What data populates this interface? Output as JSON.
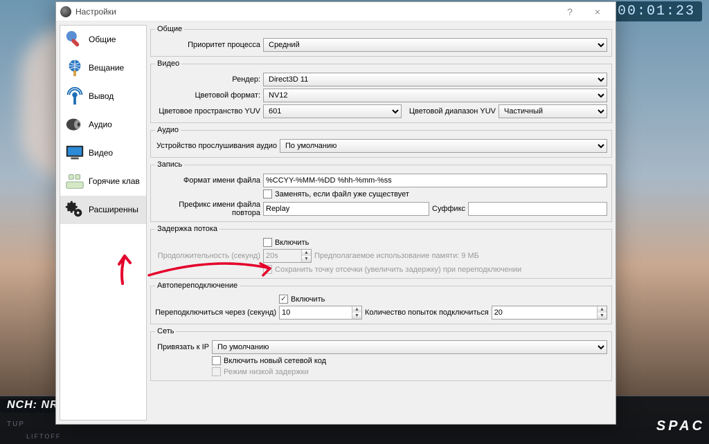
{
  "window": {
    "title": "Настройки",
    "help_btn": "?",
    "close_btn": "×"
  },
  "sidebar": {
    "items": [
      {
        "label": "Общие"
      },
      {
        "label": "Вещание"
      },
      {
        "label": "Вывод"
      },
      {
        "label": "Аудио"
      },
      {
        "label": "Видео"
      },
      {
        "label": "Горячие клав"
      },
      {
        "label": "Расширенны"
      }
    ]
  },
  "general": {
    "legend": "Общие",
    "priority_label": "Приоритет процесса",
    "priority_value": "Средний"
  },
  "video": {
    "legend": "Видео",
    "render_label": "Рендер:",
    "render_value": "Direct3D 11",
    "color_format_label": "Цветовой формат:",
    "color_format_value": "NV12",
    "yuv_space_label": "Цветовое пространство YUV",
    "yuv_space_value": "601",
    "yuv_range_label": "Цветовой диапазон YUV",
    "yuv_range_value": "Частичный"
  },
  "audio": {
    "legend": "Аудио",
    "monitor_label": "Устройство прослушивания аудио",
    "monitor_value": "По умолчанию"
  },
  "recording": {
    "legend": "Запись",
    "fmt_label": "Формат имени файла",
    "fmt_value": "%CCYY-%MM-%DD %hh-%mm-%ss",
    "replace_label": "Заменять, если файл уже существует",
    "prefix_label": "Префикс имени файла повтора",
    "prefix_value": "Replay",
    "suffix_label": "Суффикс"
  },
  "delay": {
    "legend": "Задержка потока",
    "enable_label": "Включить",
    "duration_label": "Продолжительность (секунд)",
    "duration_value": "20s",
    "memory_note": "Предполагаемое использование памяти: 9 МБ",
    "preserve_label": "Сохранить точку отсечки (увеличить задержку) при переподключении"
  },
  "reconnect": {
    "legend": "Автопереподключение",
    "enable_label": "Включить",
    "retry_label": "Переподключиться через (секунд)",
    "retry_value": "10",
    "attempts_label": "Количество попыток подключиться",
    "attempts_value": "20"
  },
  "network": {
    "legend": "Сеть",
    "bind_label": "Привязать к IP",
    "bind_value": "По умолчанию",
    "new_net_label": "Включить новый сетевой код",
    "low_latency_label": "Режим низкой задержки"
  },
  "bg": {
    "bottom_label": "NCH: NRO",
    "small1": "TUP",
    "small2": "LIFTOFF",
    "timer": "00:01:23",
    "brand": "SPAC"
  }
}
